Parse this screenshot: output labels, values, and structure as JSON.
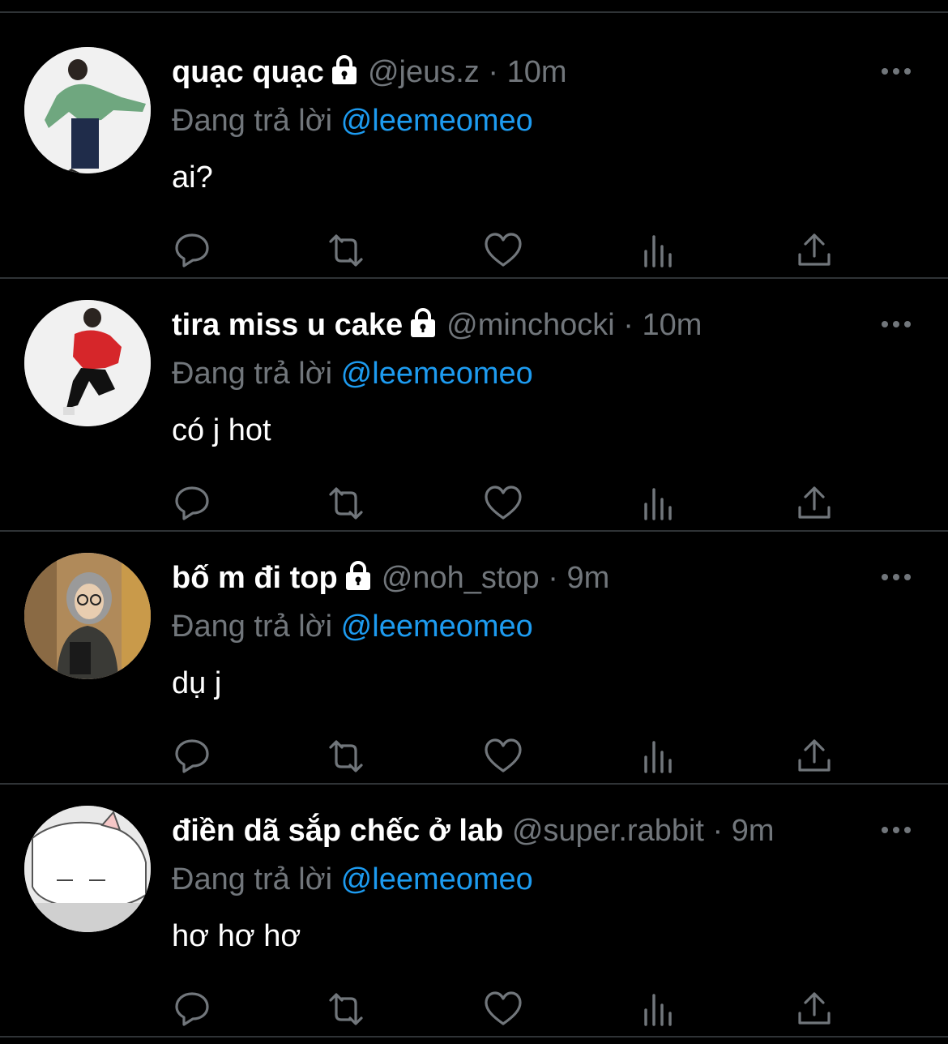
{
  "tweets": [
    {
      "display_name": "quạc quạc",
      "handle": "@jeus.z",
      "separator": "·",
      "time": "10m",
      "reply_prefix": "Đang trả lời",
      "reply_handle": "@leemeomeo",
      "text": "ai?",
      "locked": true,
      "avatar_desc": "person in green jacket jumping"
    },
    {
      "display_name": "tira miss u cake",
      "handle": "@minchocki",
      "separator": "·",
      "time": "10m",
      "reply_prefix": "Đang trả lời",
      "reply_handle": "@leemeomeo",
      "text": "có j hot",
      "locked": true,
      "avatar_desc": "person in red jacket kicking"
    },
    {
      "display_name": "bố m đi top",
      "handle": "@noh_stop",
      "separator": "·",
      "time": "9m",
      "reply_prefix": "Đang trả lời",
      "reply_handle": "@leemeomeo",
      "text": "dụ j",
      "locked": true,
      "avatar_desc": "mirror selfie with glasses"
    },
    {
      "display_name": "điền dã sắp chếc ở lab",
      "handle": "@super.rabbit",
      "separator": "·",
      "time": "9m",
      "reply_prefix": "Đang trả lời",
      "reply_handle": "@leemeomeo",
      "text": "hơ hơ hơ",
      "locked": false,
      "avatar_desc": "cartoon white cat"
    }
  ],
  "icons": {
    "lock": "lock-icon",
    "more": "more-icon",
    "reply": "reply-icon",
    "retweet": "retweet-icon",
    "like": "heart-icon",
    "views": "views-icon",
    "share": "share-icon"
  },
  "colors": {
    "background": "#000000",
    "divider": "#2f3336",
    "secondary_text": "#71767b",
    "accent": "#1d9bf0",
    "primary_text": "#ffffff"
  }
}
